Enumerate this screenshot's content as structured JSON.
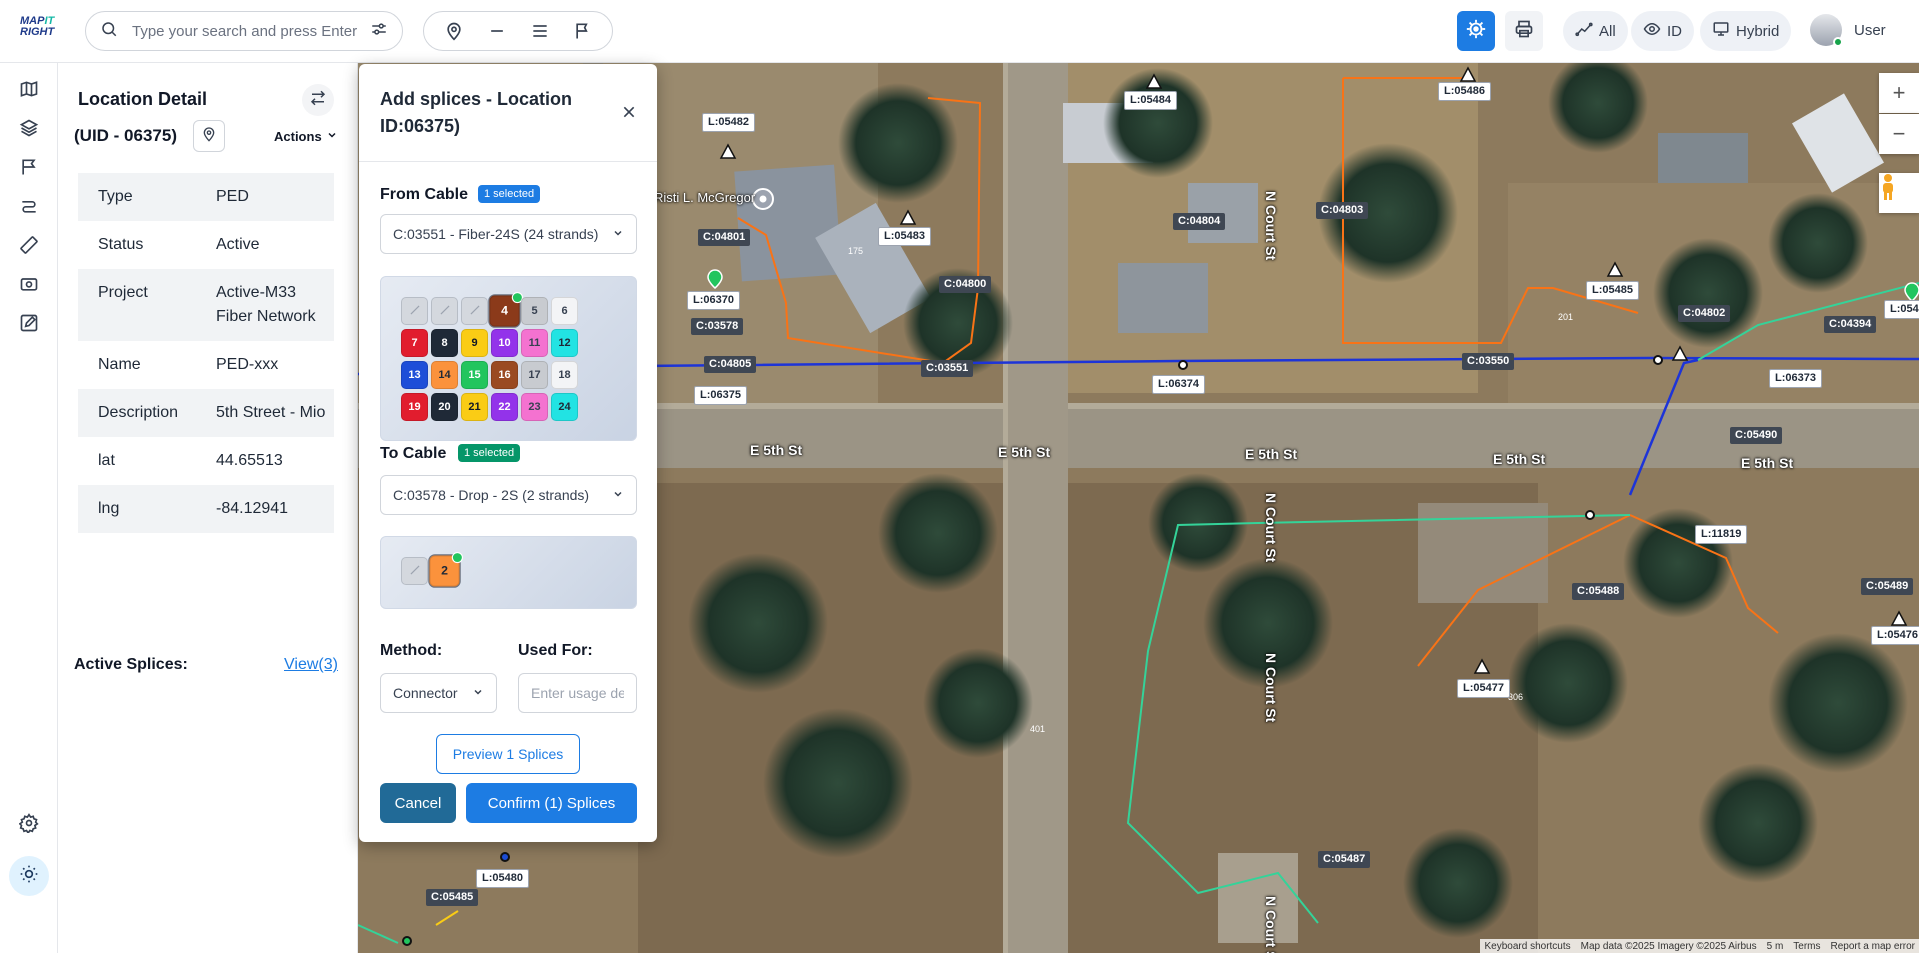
{
  "header": {
    "logo_line1": "MAP",
    "logo_line1_accent": "IT",
    "logo_line2": "RIGHT",
    "search_placeholder": "Type your search and press Enter",
    "pills": [
      {
        "label": "All",
        "icon": "chart-line-icon"
      },
      {
        "label": "ID",
        "icon": "eye-icon"
      },
      {
        "label": "Hybrid",
        "icon": "map-icon"
      }
    ],
    "user_name": "User",
    "colors": {
      "primary": "#1d7ce3",
      "online": "#16a34a"
    }
  },
  "location_detail": {
    "title": "Location Detail",
    "uid": "(UID - 06375)",
    "actions_label": "Actions",
    "rows": [
      {
        "key": "Type",
        "value": "PED"
      },
      {
        "key": "Status",
        "value": "Active"
      },
      {
        "key": "Project",
        "value": "Active-M33 Fiber Network"
      },
      {
        "key": "Name",
        "value": "PED-xxx"
      },
      {
        "key": "Description",
        "value": "5th Street - Mio"
      },
      {
        "key": "lat",
        "value": "44.65513"
      },
      {
        "key": "lng",
        "value": "-84.12941"
      }
    ],
    "active_splices_label": "Active Splices:",
    "active_splices_link": "View(3)"
  },
  "modal": {
    "title": "Add splices - Location ID:06375)",
    "from_cable_label": "From Cable",
    "from_cable_badge": "1 selected",
    "from_cable_value": "C:03551 - Fiber-24S (24 strands)",
    "from_fibers": [
      {
        "n": "",
        "bg": "#d4d8de",
        "fg": "#9ca3af",
        "used": true
      },
      {
        "n": "",
        "bg": "#d4d8de",
        "fg": "#9ca3af",
        "used": true
      },
      {
        "n": "",
        "bg": "#d4d8de",
        "fg": "#9ca3af",
        "used": true
      },
      {
        "n": "4",
        "bg": "#8b3a1a",
        "fg": "#ffffff",
        "selected": true
      },
      {
        "n": "5",
        "bg": "#c8cbd0",
        "fg": "#374151"
      },
      {
        "n": "6",
        "bg": "#f3f4f6",
        "fg": "#374151"
      },
      {
        "n": "7",
        "bg": "#e11d2e",
        "fg": "#ffffff"
      },
      {
        "n": "8",
        "bg": "#1f2937",
        "fg": "#ffffff"
      },
      {
        "n": "9",
        "bg": "#facc15",
        "fg": "#111827"
      },
      {
        "n": "10",
        "bg": "#9333ea",
        "fg": "#ffffff"
      },
      {
        "n": "11",
        "bg": "#f472d0",
        "fg": "#374151"
      },
      {
        "n": "12",
        "bg": "#22e3e3",
        "fg": "#1f2937"
      },
      {
        "n": "13",
        "bg": "#1d4ed8",
        "fg": "#ffffff"
      },
      {
        "n": "14",
        "bg": "#fb923c",
        "fg": "#1f2937"
      },
      {
        "n": "15",
        "bg": "#22c55e",
        "fg": "#ffffff"
      },
      {
        "n": "16",
        "bg": "#9a4a22",
        "fg": "#ffffff"
      },
      {
        "n": "17",
        "bg": "#c8cbd0",
        "fg": "#374151"
      },
      {
        "n": "18",
        "bg": "#f3f4f6",
        "fg": "#374151"
      },
      {
        "n": "19",
        "bg": "#e11d2e",
        "fg": "#ffffff"
      },
      {
        "n": "20",
        "bg": "#1f2937",
        "fg": "#ffffff"
      },
      {
        "n": "21",
        "bg": "#facc15",
        "fg": "#111827"
      },
      {
        "n": "22",
        "bg": "#9333ea",
        "fg": "#ffffff"
      },
      {
        "n": "23",
        "bg": "#f472d0",
        "fg": "#374151"
      },
      {
        "n": "24",
        "bg": "#22e3e3",
        "fg": "#1f2937"
      }
    ],
    "to_cable_label": "To Cable",
    "to_cable_badge": "1 selected",
    "to_cable_value": "C:03578 - Drop - 2S (2 strands)",
    "to_fibers": [
      {
        "n": "",
        "bg": "#d4d8de",
        "fg": "#9ca3af",
        "used": true
      },
      {
        "n": "2",
        "bg": "#fb923c",
        "fg": "#1f2937",
        "selected": true
      }
    ],
    "method_label": "Method:",
    "method_value": "Connector",
    "used_for_label": "Used For:",
    "used_for_placeholder": "Enter usage details",
    "preview_label": "Preview 1 Splices",
    "cancel_label": "Cancel",
    "confirm_label": "Confirm (1) Splices"
  },
  "map": {
    "labels_dark": [
      "C:04801",
      "C:03578",
      "C:04805",
      "C:03551",
      "C:04800",
      "C:04804",
      "C:04803",
      "C:03550",
      "C:04802",
      "C:04394",
      "C:05490",
      "C:05488",
      "C:05489",
      "C:05487",
      "C:05485"
    ],
    "labels_light": [
      "L:05482",
      "L:06370",
      "L:06375",
      "L:05483",
      "L:05484",
      "L:06374",
      "L:05486",
      "L:05485",
      "L:06373",
      "L:11819",
      "L:05477",
      "L:05476",
      "L:05480",
      "L:054"
    ],
    "streets": [
      "E 5th St",
      "E 5th St",
      "E 5th St",
      "E 5th St",
      "E 5th St",
      "N Court St",
      "N Court St",
      "N Court St",
      "N Court St"
    ],
    "poi": "Risti L. McGregor",
    "house_numbers": [
      "175",
      "201",
      "401",
      "306"
    ],
    "attribution": [
      "Keyboard shortcuts",
      "Map data ©2025 Imagery ©2025 Airbus",
      "5 m",
      "Terms",
      "Report a map error"
    ],
    "colors": {
      "feeder": "#1d34d8",
      "drop": "#f97316",
      "green": "#34d399"
    }
  }
}
